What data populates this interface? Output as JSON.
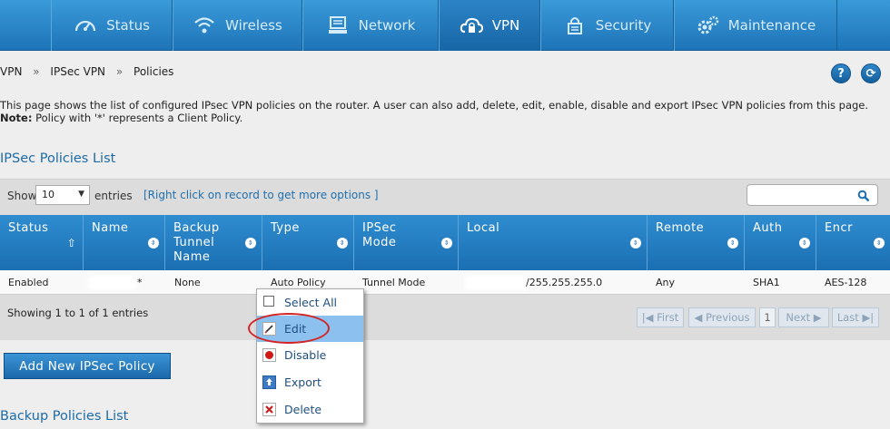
{
  "nav": {
    "items": [
      {
        "label": "Status",
        "icon": "gauge-icon"
      },
      {
        "label": "Wireless",
        "icon": "wifi-icon"
      },
      {
        "label": "Network",
        "icon": "monitor-icon"
      },
      {
        "label": "VPN",
        "icon": "cloud-lock-icon",
        "active": true
      },
      {
        "label": "Security",
        "icon": "lock-icon"
      },
      {
        "label": "Maintenance",
        "icon": "gears-icon"
      }
    ]
  },
  "breadcrumb": {
    "items": [
      "VPN",
      "IPSec VPN",
      "Policies"
    ],
    "separator": "»"
  },
  "help": {
    "label": "?"
  },
  "refresh": {
    "label": "⟳"
  },
  "description": {
    "line1": "This page shows the list of configured IPsec VPN policies on the router. A user can also add, delete, edit, enable, disable and export IPsec VPN policies from this page.",
    "note_label": "Note:",
    "note_text": " Policy with '*' represents a Client Policy."
  },
  "policies_title": "IPSec Policies List",
  "toolbar": {
    "show_label": "Show",
    "page_size": "10",
    "entries_label": "entries",
    "hint": "[Right click on record to get more options ]",
    "search_value": ""
  },
  "table": {
    "columns": [
      "Status",
      "Name",
      "Backup Tunnel Name",
      "Type",
      "IPSec Mode",
      "Local",
      "Remote",
      "Auth",
      "Encr"
    ],
    "rows": [
      {
        "status": "Enabled",
        "name": "*",
        "backup": "None",
        "type": "Auto Policy",
        "mode": "Tunnel Mode",
        "local": "/255.255.255.0",
        "remote": "Any",
        "auth": "SHA1",
        "encr": "AES-128"
      }
    ]
  },
  "footer": {
    "info": "Showing 1 to 1 of 1 entries",
    "first": "First",
    "previous": "Previous",
    "page": "1",
    "next": "Next",
    "last": "Last"
  },
  "add_button": "Add New IPSec Policy",
  "backup_title": "Backup Policies List",
  "context_menu": {
    "items": [
      {
        "label": "Select All",
        "icon": "checkbox-icon"
      },
      {
        "label": "Edit",
        "icon": "pencil-icon",
        "highlighted": true
      },
      {
        "label": "Disable",
        "icon": "red-dot-icon"
      },
      {
        "label": "Export",
        "icon": "export-icon"
      },
      {
        "label": "Delete",
        "icon": "delete-x-icon"
      }
    ]
  },
  "colors": {
    "brand_blue": "#1e74b8",
    "annotation_red": "#d42424",
    "menu_highlight": "#8cc0ee"
  }
}
